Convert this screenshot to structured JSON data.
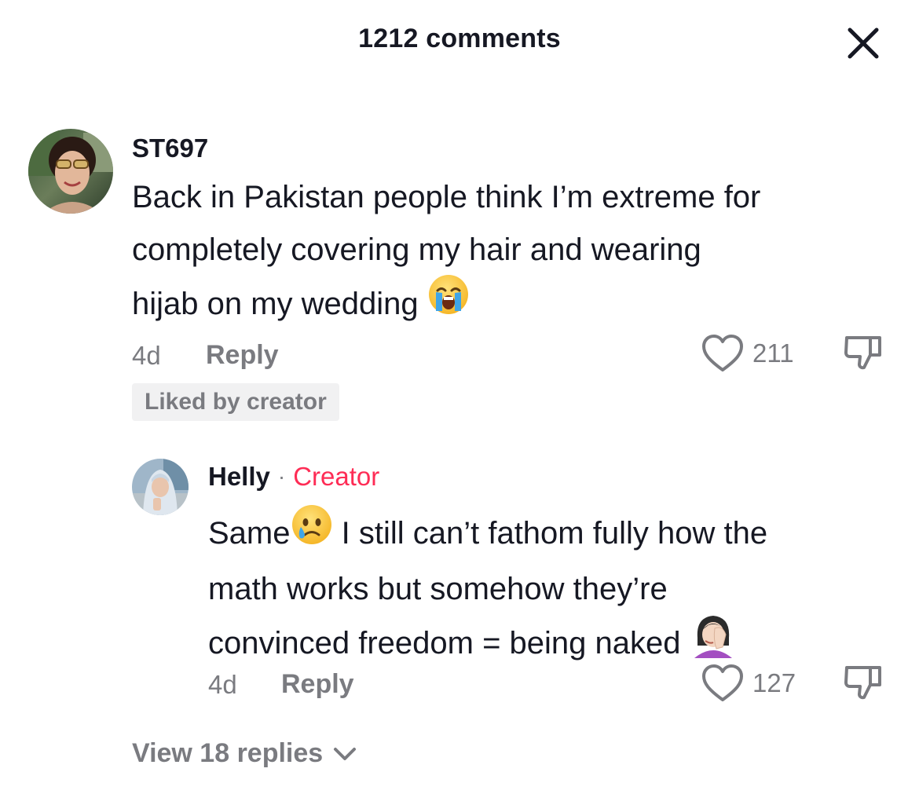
{
  "header": {
    "title": "1212 comments"
  },
  "comment": {
    "username": "ST697",
    "text_line1": "Back in Pakistan people think I’m extreme for",
    "text_line2": "completely covering my hair and wearing",
    "text_line3": "hijab on my wedding",
    "text_emoji": "loudly-crying-face",
    "time": "4d",
    "reply_label": "Reply",
    "likes": "211",
    "badge": "Liked by creator"
  },
  "reply": {
    "username": "Helly",
    "separator": "·",
    "creator_tag": "Creator",
    "text_line1_a": "Same",
    "text_line1_emoji": "sad-but-relieved-face",
    "text_line1_b": " I still can’t fathom fully how the",
    "text_line2": "math works but somehow they’re",
    "text_line3": "convinced freedom = being naked ",
    "text_line3_emoji": "woman-facepalming",
    "time": "4d",
    "reply_label": "Reply",
    "likes": "127"
  },
  "view_replies": {
    "label": "View 18 replies",
    "icon": "chevron-down-icon"
  },
  "colors": {
    "text_primary": "#161823",
    "text_secondary": "#7a7b80",
    "creator_accent": "#fe2c55",
    "badge_bg": "#f1f1f2"
  }
}
